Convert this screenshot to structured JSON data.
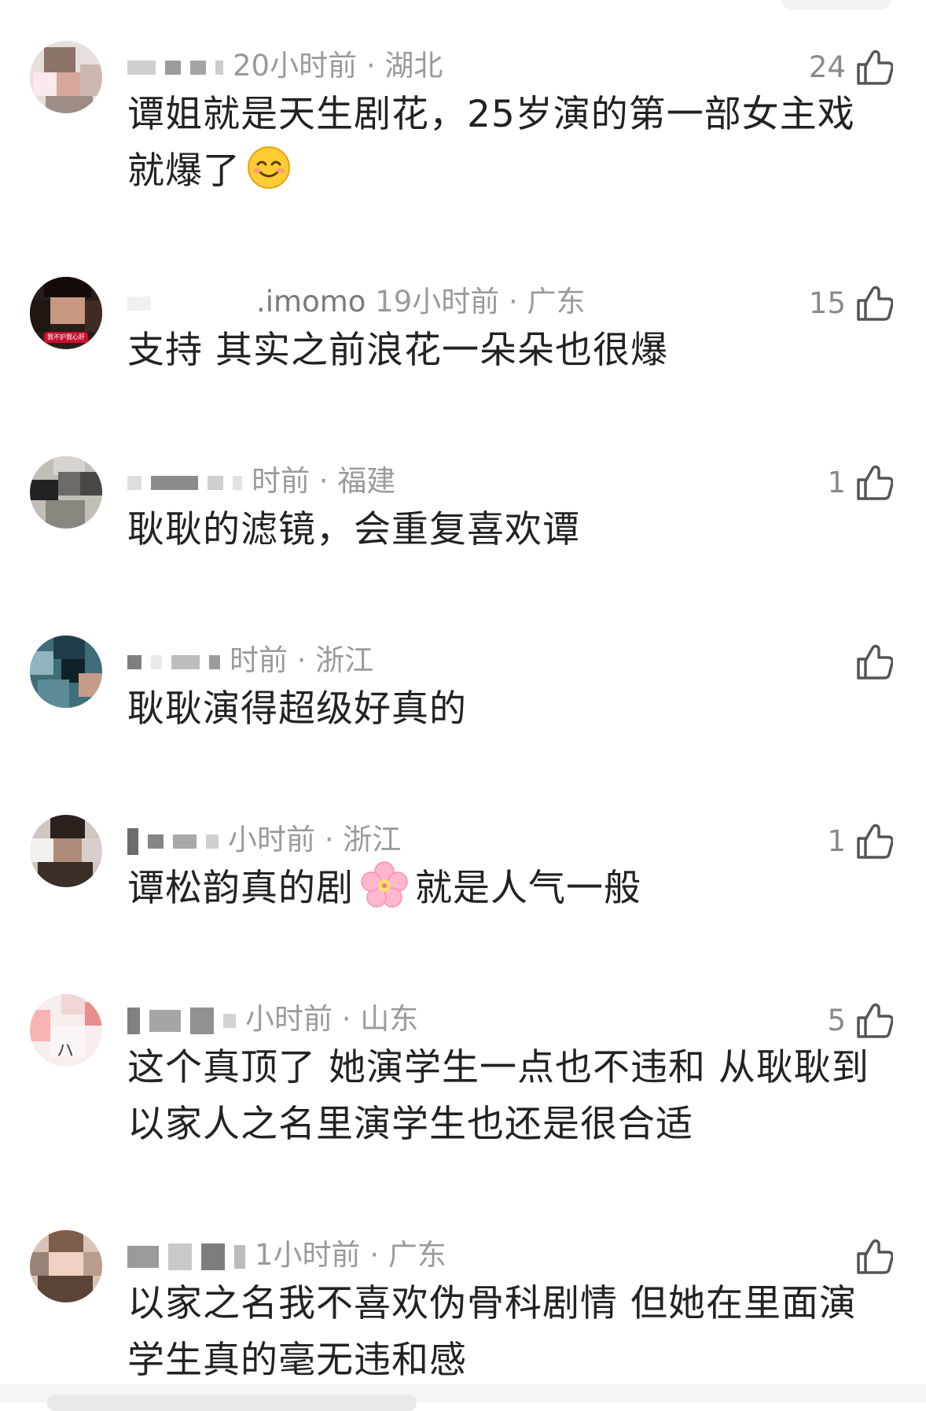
{
  "comments": [
    {
      "meta": "20小时前 · 湖北",
      "likes": "24",
      "text": "谭姐就是天生剧花，25岁演的第一部女主戏就爆了",
      "emoji": "smiling-face"
    },
    {
      "user": ".imomo",
      "meta": "19小时前 · 广东",
      "likes": "15",
      "text": "支持 其实之前浪花一朵朵也很爆"
    },
    {
      "meta": "时前 · 福建",
      "likes": "1",
      "text": "耿耿的滤镜，会重复喜欢谭"
    },
    {
      "meta": "时前 · 浙江",
      "likes": "",
      "text": "耿耿演得超级好真的"
    },
    {
      "meta": "小时前 · 浙江",
      "likes": "1",
      "text_before": "谭松韵真的剧",
      "text_after": "就是人气一般",
      "emoji": "cherry-blossom"
    },
    {
      "meta": "小时前 · 山东",
      "likes": "5",
      "text": "这个真顶了 她演学生一点也不违和 从耿耿到以家人之名里演学生也还是很合适"
    },
    {
      "meta": "1小时前 · 广东",
      "likes": "",
      "text": "以家之名我不喜欢伪骨科剧情 但她在里面演学生真的毫无违和感"
    }
  ],
  "avatar_text": "我不护我心肝",
  "icons": {
    "like": "thumbs-up-icon"
  },
  "colors": {
    "meta": "#9a9a9a",
    "body": "#222222"
  }
}
